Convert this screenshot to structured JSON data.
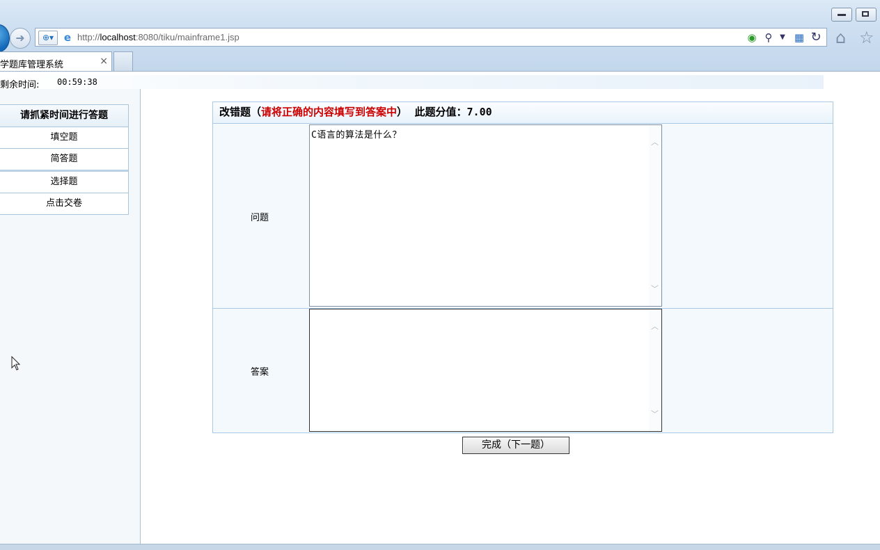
{
  "browser": {
    "url_prefix": "http://",
    "url_host": "localhost",
    "url_rest": ":8080/tiku/mainframe1.jsp",
    "tab_title": "学题库管理系统",
    "tab_close": "×"
  },
  "timer": {
    "label": "剩余时间:",
    "value": "00:59:38"
  },
  "sidebar": {
    "header": "请抓紧时间进行答题",
    "items": [
      {
        "label": "填空题"
      },
      {
        "label": "简答题"
      },
      {
        "label": "选择题"
      },
      {
        "label": "点击交卷"
      }
    ]
  },
  "question": {
    "type_label": "改错题（",
    "instruction": "请将正确的内容填写到答案中",
    "close_paren": "）",
    "score_label": "此题分值：",
    "score_value": "7.00",
    "question_label": "问题",
    "question_text": "C语言的算法是什么？",
    "answer_label": "答案",
    "answer_text": "",
    "next_button": "完成（下一题）"
  },
  "colors": {
    "accent_red": "#cc0000",
    "panel_border": "#a9c9e4",
    "panel_bg": "#f3f9fd"
  },
  "icons": [
    "back-icon",
    "forward-icon",
    "compat-view-icon",
    "ie-page-icon",
    "refresh-green-icon",
    "search-icon",
    "dropdown-icon",
    "image-icon",
    "reload-icon",
    "home-icon",
    "favorites-star-icon",
    "tab-close-icon",
    "mouse-cursor-icon",
    "scroll-up-icon",
    "scroll-down-icon"
  ]
}
